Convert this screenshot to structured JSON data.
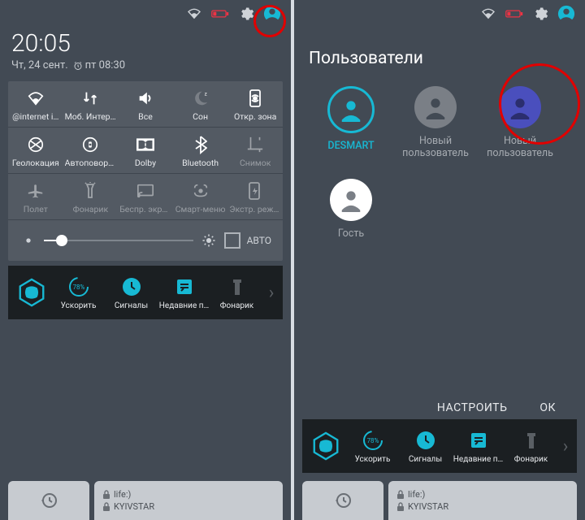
{
  "left": {
    "time": "20:05",
    "date": "Чт, 24 сент.",
    "alarm": "пт 08:30",
    "qs": {
      "row1": [
        {
          "icon": "wifi",
          "label": "@internet i…"
        },
        {
          "icon": "data",
          "label": "Моб. Интернет"
        },
        {
          "icon": "volume",
          "label": "Все"
        },
        {
          "icon": "sleep",
          "label": "Сон"
        },
        {
          "icon": "hotspot",
          "label": "Откр. зона"
        }
      ],
      "row2": [
        {
          "icon": "geo",
          "label": "Геолокация"
        },
        {
          "icon": "rotate",
          "label": "Автоповорот"
        },
        {
          "icon": "dolby",
          "label": "Dolby"
        },
        {
          "icon": "bt",
          "label": "Bluetooth"
        },
        {
          "icon": "snip",
          "label": "Снимок",
          "off": true
        }
      ],
      "row3": [
        {
          "icon": "plane",
          "label": "Полет",
          "off": true
        },
        {
          "icon": "torch",
          "label": "Фонарик",
          "off": true
        },
        {
          "icon": "cast",
          "label": "Беспр. экран",
          "off": true
        },
        {
          "icon": "smart",
          "label": "Смарт-меню",
          "off": true
        },
        {
          "icon": "power",
          "label": "Экстр. режим",
          "off": true
        }
      ]
    },
    "brightness": {
      "auto_label": "АВТО"
    },
    "dock": [
      {
        "label": "Ускорить"
      },
      {
        "label": "Сигналы",
        "pct": "78%"
      },
      {
        "label": "Недавние п…"
      },
      {
        "label": "Фонарик"
      }
    ],
    "bottom_sims": [
      "life:)",
      "KYIVSTAR"
    ]
  },
  "right": {
    "title": "Пользователи",
    "users": [
      {
        "name": "DESMART",
        "kind": "active"
      },
      {
        "name": "Новый пользователь",
        "kind": "gray"
      },
      {
        "name": "Новый пользователь",
        "kind": "blue"
      },
      {
        "name": "Гость",
        "kind": "white"
      }
    ],
    "actions": {
      "configure": "НАСТРОИТЬ",
      "ok": "ОК"
    },
    "dock": [
      {
        "label": "Ускорить"
      },
      {
        "label": "Сигналы",
        "pct": "78%"
      },
      {
        "label": "Недавние п…"
      },
      {
        "label": "Фонарик"
      }
    ],
    "bottom_sims": [
      "life:)",
      "KYIVSTAR"
    ]
  }
}
